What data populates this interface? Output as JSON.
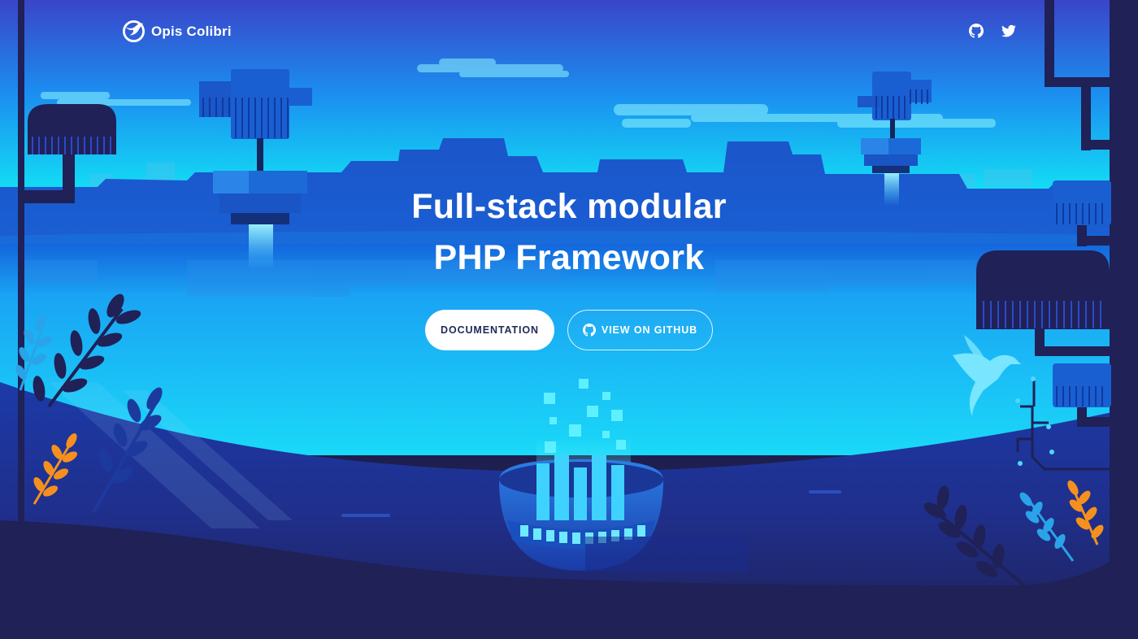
{
  "brand": {
    "name": "Opis Colibri",
    "logo_icon": "hummingbird-logo-icon"
  },
  "nav": {
    "social": [
      {
        "name": "GitHub",
        "icon": "github-icon"
      },
      {
        "name": "Twitter",
        "icon": "twitter-icon"
      }
    ]
  },
  "hero": {
    "headline_line1": "Full-stack modular",
    "headline_line2": "PHP Framework",
    "primary_button": "DOCUMENTATION",
    "secondary_button": "VIEW ON GITHUB",
    "secondary_button_icon": "github-icon"
  },
  "colors": {
    "sky_top": "#3a45c9",
    "sky_mid": "#1d8cf0",
    "horizon_glow": "#17f0f4",
    "lake": "#1da9f5",
    "ground": "#1f2157",
    "accent_orange": "#f5901e",
    "text": "#ffffff",
    "button_text_dark": "#1f2a57"
  }
}
